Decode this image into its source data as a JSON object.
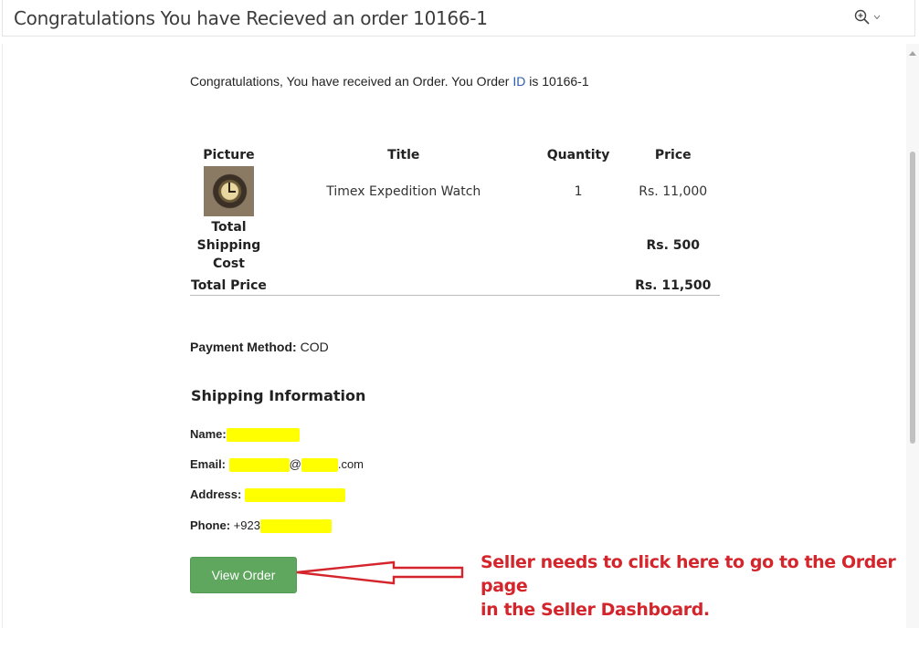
{
  "header": {
    "title": "Congratulations You have Recieved an order 10166-1"
  },
  "intro": {
    "text_before": "Congratulations, You have received an Order. You Order ",
    "id_word": "ID",
    "text_after": " is 10166-1"
  },
  "table": {
    "headers": [
      "Picture",
      "Title",
      "Quantity",
      "Price"
    ],
    "item": {
      "title": "Timex Expedition Watch",
      "quantity": "1",
      "price": "Rs. 11,000"
    },
    "total_label": "Total",
    "shipping_label": "Shipping Cost",
    "shipping_value": "Rs. 500",
    "total_price_label": "Total Price",
    "total_price_value": "Rs. 11,500"
  },
  "payment": {
    "label": "Payment Method:",
    "value": " COD"
  },
  "shipping": {
    "title": "Shipping Information",
    "name_label": "Name:",
    "email_label": "Email:",
    "email_at": "@",
    "email_suffix": ".com",
    "address_label": "Address:",
    "phone_label": "Phone:",
    "phone_prefix": " +923"
  },
  "button": {
    "label": "View Order"
  },
  "annotation": {
    "line1": "Seller needs to click here to go to the Order page",
    "line2": "in the Seller Dashboard."
  },
  "colors": {
    "button": "#5fa75e",
    "annotation": "#d3252b",
    "highlight": "#ffff00"
  }
}
